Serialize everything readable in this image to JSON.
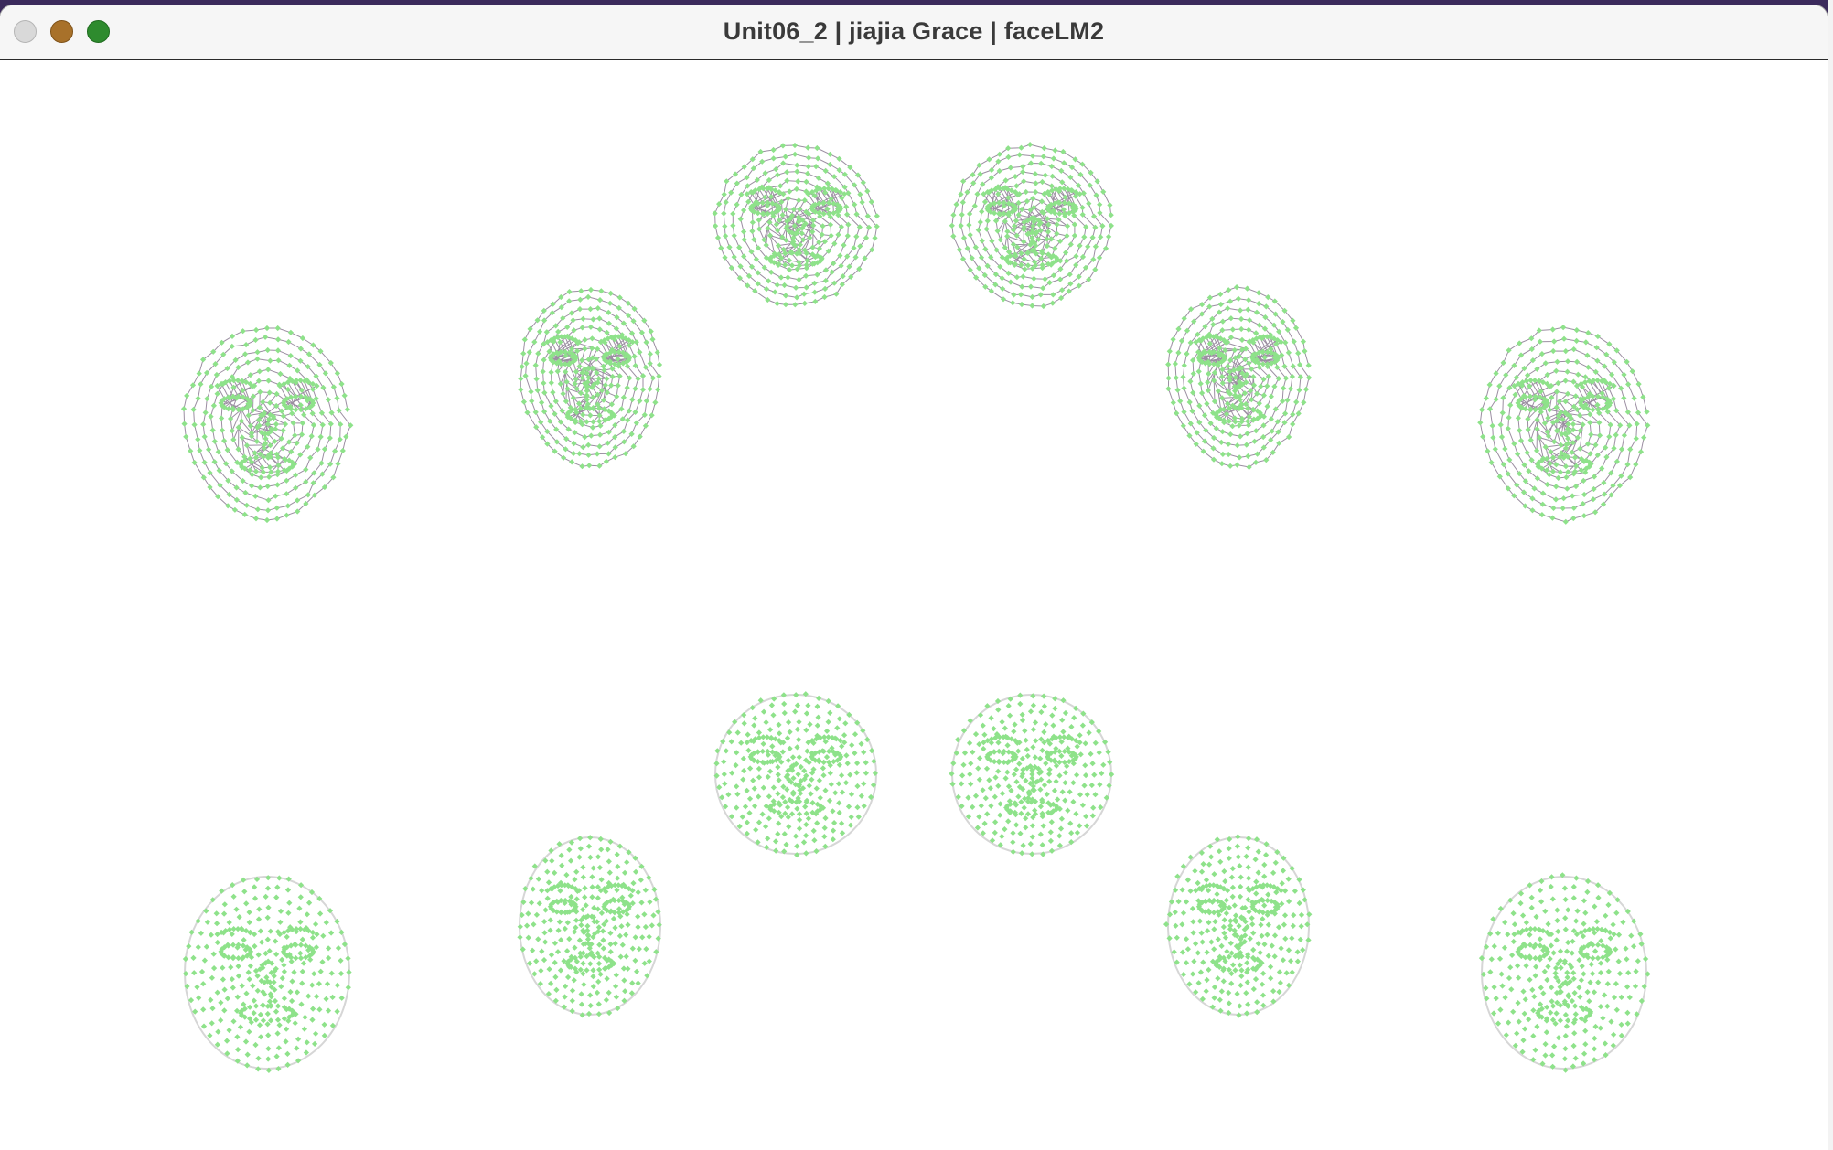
{
  "window": {
    "title": "Unit06_2 | jiajia Grace | faceLM2",
    "buttons": {
      "close": "close-button",
      "minimize": "minimize-button",
      "zoom": "zoom-button"
    }
  },
  "colors": {
    "landmark_point": "#8ee28a",
    "mesh_edge": "#8a7a90",
    "contour": "#d6d6d6",
    "background": "#ffffff"
  },
  "canvas": {
    "top_row_style": "mesh-with-points",
    "bottom_row_style": "points-only",
    "face_count_per_row": 6
  }
}
